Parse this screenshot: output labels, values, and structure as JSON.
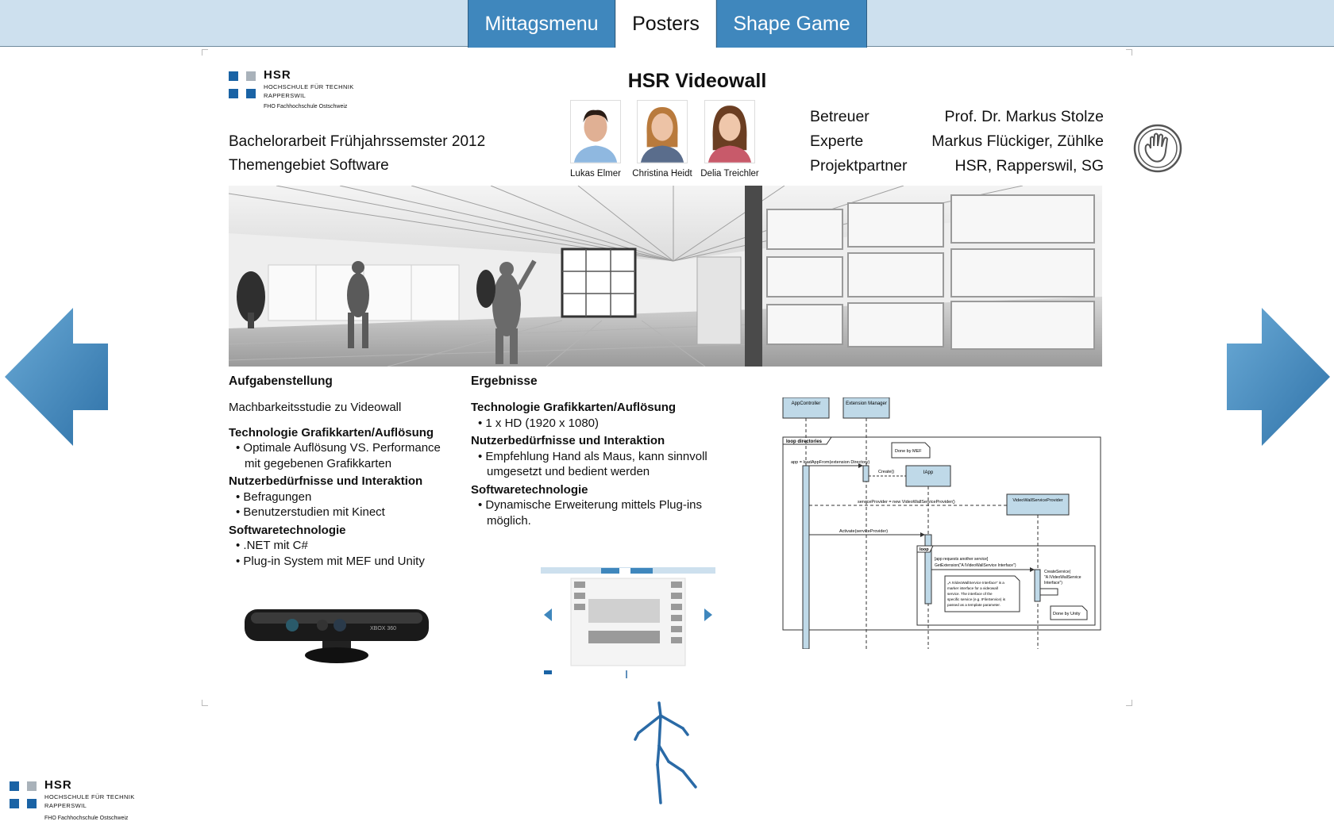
{
  "tabs": [
    {
      "label": "Mittagsmenu",
      "active": false
    },
    {
      "label": "Posters",
      "active": true
    },
    {
      "label": "Shape Game",
      "active": false
    }
  ],
  "colors": {
    "accent": "#3f87bd",
    "topbar": "#cde0ee",
    "arrow": "#3f87bd",
    "skeleton": "#2a6aa6"
  },
  "nav": {
    "prev_icon": "left-arrow-icon",
    "next_icon": "right-arrow-icon"
  },
  "poster": {
    "logo": {
      "name": "HSR",
      "line1": "HOCHSCHULE FÜR TECHNIK",
      "line2": "RAPPERSWIL",
      "line3": "FHO Fachhochschule Ostschweiz"
    },
    "title": "HSR Videowall",
    "subtitle1": "Bachelorarbeit Frühjahrssemster 2012",
    "subtitle2": "Themengebiet Software",
    "people": [
      "Lukas Elmer",
      "Christina Heidt",
      "Delia Treichler"
    ],
    "info": [
      {
        "label": "Betreuer",
        "value": "Prof. Dr. Markus Stolze"
      },
      {
        "label": "Experte",
        "value": "Markus Flückiger, Zühlke"
      },
      {
        "label": "Projektpartner",
        "value": "HSR, Rapperswil, SG"
      }
    ],
    "left_col": {
      "heading": "Aufgabenstellung",
      "intro": "Machbarkeitsstudie zu Videowall",
      "s1_title": "Technologie Grafikkarten/Auflösung",
      "s1_b1": "• Optimale Auflösung VS. Performance mit gegebenen Grafikkarten",
      "s2_title": "Nutzerbedürfnisse und Interaktion",
      "s2_b1": "• Befragungen",
      "s2_b2": "• Benutzerstudien mit Kinect",
      "s3_title": "Softwaretechnologie",
      "s3_b1": "• .NET mit C#",
      "s3_b2": "• Plug-in System mit MEF und Unity"
    },
    "mid_col": {
      "heading": "Ergebnisse",
      "s1_title": "Technologie Grafikkarten/Auflösung",
      "s1_b1": "• 1 x HD (1920 x 1080)",
      "s2_title": "Nutzerbedürfnisse und Interaktion",
      "s2_b1": "• Empfehlung Hand als Maus, kann sinnvoll umgesetzt und bedient werden",
      "s3_title": "Softwaretechnologie",
      "s3_b1": "• Dynamische Erweiterung mittels Plug-ins möglich."
    },
    "kinect_label": "XBOX 360",
    "diagram": {
      "obj1": "AppController",
      "obj2": "Extension Manager",
      "frame1": "loop directories",
      "m1": "app = loadAppFrom(extension Directory)",
      "note1": "Done by MEF",
      "m2": "Create()",
      "obj3": "IApp",
      "m3": "serviceProvider = new VideoWallServiceProvider()",
      "obj4": "VideoWallServiceProvider",
      "m4": "Activate(serviceProvider)",
      "frame2": "loop",
      "guard": "[app requests another service]",
      "m5": "GetExtension(\"A IVideoWallService Interface\")",
      "m6": "CreateService(",
      "m6b": "\"A IVideoWallService",
      "m6c": "Interface\")",
      "note2a": "„A IVideoWallService Interface\" is a",
      "note2b": "marker interface for a videowall",
      "note2c": "service. The interface of the",
      "note2d": "specific service (e.g. IFileService) is",
      "note2e": "passed as a template parameter.",
      "note3": "Done by Unity"
    }
  },
  "footer_logo": {
    "name": "HSR",
    "line1": "HOCHSCHULE FÜR TECHNIK",
    "line2": "RAPPERSWIL",
    "line3": "FHO Fachhochschule Ostschweiz"
  },
  "cursor_icon": "skeleton-tracking-icon"
}
